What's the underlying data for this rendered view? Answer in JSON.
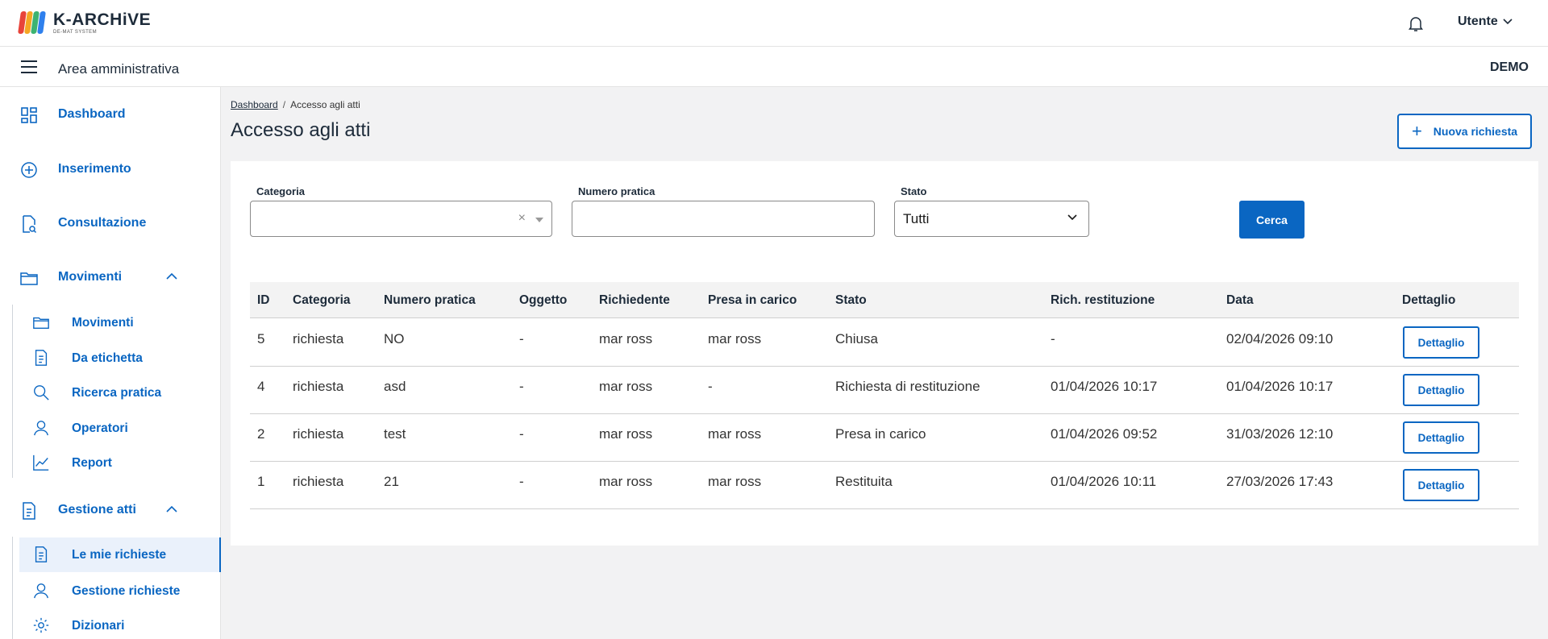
{
  "header": {
    "logo_title": "K-ARCHiVE",
    "logo_subtitle": "DE-MAT SYSTEM",
    "user_label": "Utente",
    "logo_colors": [
      "#e8443a",
      "#f5a623",
      "#3cb371",
      "#2f80ed"
    ]
  },
  "subbar": {
    "area_title": "Area amministrativa",
    "tenant": "DEMO"
  },
  "sidebar": {
    "items": [
      {
        "label": "Dashboard",
        "icon": "dashboard-icon"
      },
      {
        "label": "Inserimento",
        "icon": "plus-circle-icon"
      },
      {
        "label": "Consultazione",
        "icon": "document-search-icon"
      },
      {
        "label": "Movimenti",
        "icon": "folder-icon",
        "expanded": true
      },
      {
        "label": "Gestione atti",
        "icon": "document-icon",
        "expanded": true
      }
    ],
    "movimenti_sub": [
      {
        "label": "Movimenti",
        "icon": "folder-icon"
      },
      {
        "label": "Da etichetta",
        "icon": "document-icon"
      },
      {
        "label": "Ricerca pratica",
        "icon": "search-icon"
      },
      {
        "label": "Operatori",
        "icon": "user-icon"
      },
      {
        "label": "Report",
        "icon": "chart-icon"
      }
    ],
    "gestione_sub": [
      {
        "label": "Le mie richieste",
        "icon": "document-icon",
        "active": true
      },
      {
        "label": "Gestione richieste",
        "icon": "user-icon"
      },
      {
        "label": "Dizionari",
        "icon": "gear-icon"
      }
    ]
  },
  "breadcrumb": {
    "home": "Dashboard",
    "separator": "/",
    "current": "Accesso agli atti"
  },
  "page": {
    "title": "Accesso agli atti",
    "new_button": "Nuova richiesta"
  },
  "filters": {
    "categoria_label": "Categoria",
    "categoria_value": "",
    "numero_label": "Numero pratica",
    "numero_value": "",
    "stato_label": "Stato",
    "stato_value": "Tutti",
    "search_button": "Cerca"
  },
  "table": {
    "columns": [
      "ID",
      "Categoria",
      "Numero pratica",
      "Oggetto",
      "Richiedente",
      "Presa in carico",
      "Stato",
      "Rich. restituzione",
      "Data",
      "Dettaglio"
    ],
    "rows": [
      {
        "id": "5",
        "categoria": "richiesta",
        "numero": "NO",
        "oggetto": "-",
        "richiedente": "mar ross",
        "presa": "mar ross",
        "stato": "Chiusa",
        "rich": "-",
        "data": "02/04/2026 09:10",
        "btn": "Dettaglio"
      },
      {
        "id": "4",
        "categoria": "richiesta",
        "numero": "asd",
        "oggetto": "-",
        "richiedente": "mar ross",
        "presa": "-",
        "stato": "Richiesta di restituzione",
        "rich": "01/04/2026 10:17",
        "data": "01/04/2026 10:17",
        "btn": "Dettaglio"
      },
      {
        "id": "2",
        "categoria": "richiesta",
        "numero": "test",
        "oggetto": "-",
        "richiedente": "mar ross",
        "presa": "mar ross",
        "stato": "Presa in carico",
        "rich": "01/04/2026 09:52",
        "data": "31/03/2026 12:10",
        "btn": "Dettaglio"
      },
      {
        "id": "1",
        "categoria": "richiesta",
        "numero": "21",
        "oggetto": "-",
        "richiedente": "mar ross",
        "presa": "mar ross",
        "stato": "Restituita",
        "rich": "01/04/2026 10:11",
        "data": "27/03/2026 17:43",
        "btn": "Dettaglio"
      }
    ]
  },
  "colors": {
    "accent": "#0a66c2",
    "text_dark": "#1d2b3a"
  }
}
